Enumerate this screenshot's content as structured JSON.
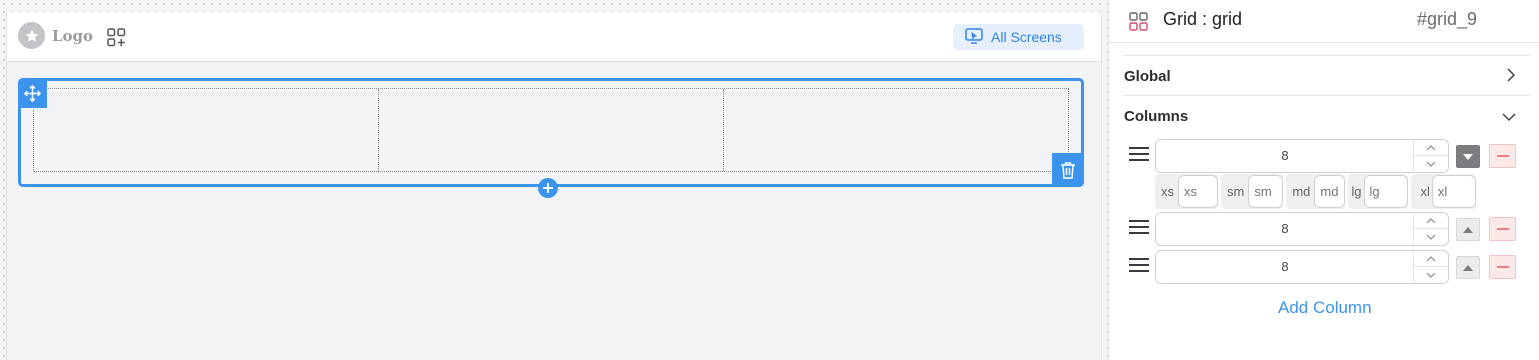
{
  "canvas": {
    "logo_text": "Logo",
    "screens_button_label": "All Screens"
  },
  "panel": {
    "title": "Grid : grid",
    "element_id": "#grid_9",
    "sections": {
      "global": "Global",
      "columns": "Columns"
    },
    "columns": [
      {
        "value": "8",
        "expanded": true
      },
      {
        "value": "8",
        "expanded": false
      },
      {
        "value": "8",
        "expanded": false
      }
    ],
    "breakpoints": [
      {
        "label": "xs",
        "placeholder": "xs"
      },
      {
        "label": "sm",
        "placeholder": "sm"
      },
      {
        "label": "md",
        "placeholder": "md"
      },
      {
        "label": "lg",
        "placeholder": "lg"
      },
      {
        "label": "xl",
        "placeholder": "xl"
      }
    ],
    "add_column_label": "Add Column"
  },
  "colors": {
    "accent": "#3b93ee",
    "danger": "#e87b7b",
    "danger_bg": "#fde8e8"
  },
  "icons": [
    "star-icon",
    "add-component-icon",
    "screen-icon",
    "move-icon",
    "trash-icon",
    "plus-icon",
    "grid-icon",
    "chevron-right-icon",
    "chevron-down-icon",
    "drag-handle-icon",
    "caret-up-icon",
    "caret-down-icon",
    "minus-icon"
  ]
}
